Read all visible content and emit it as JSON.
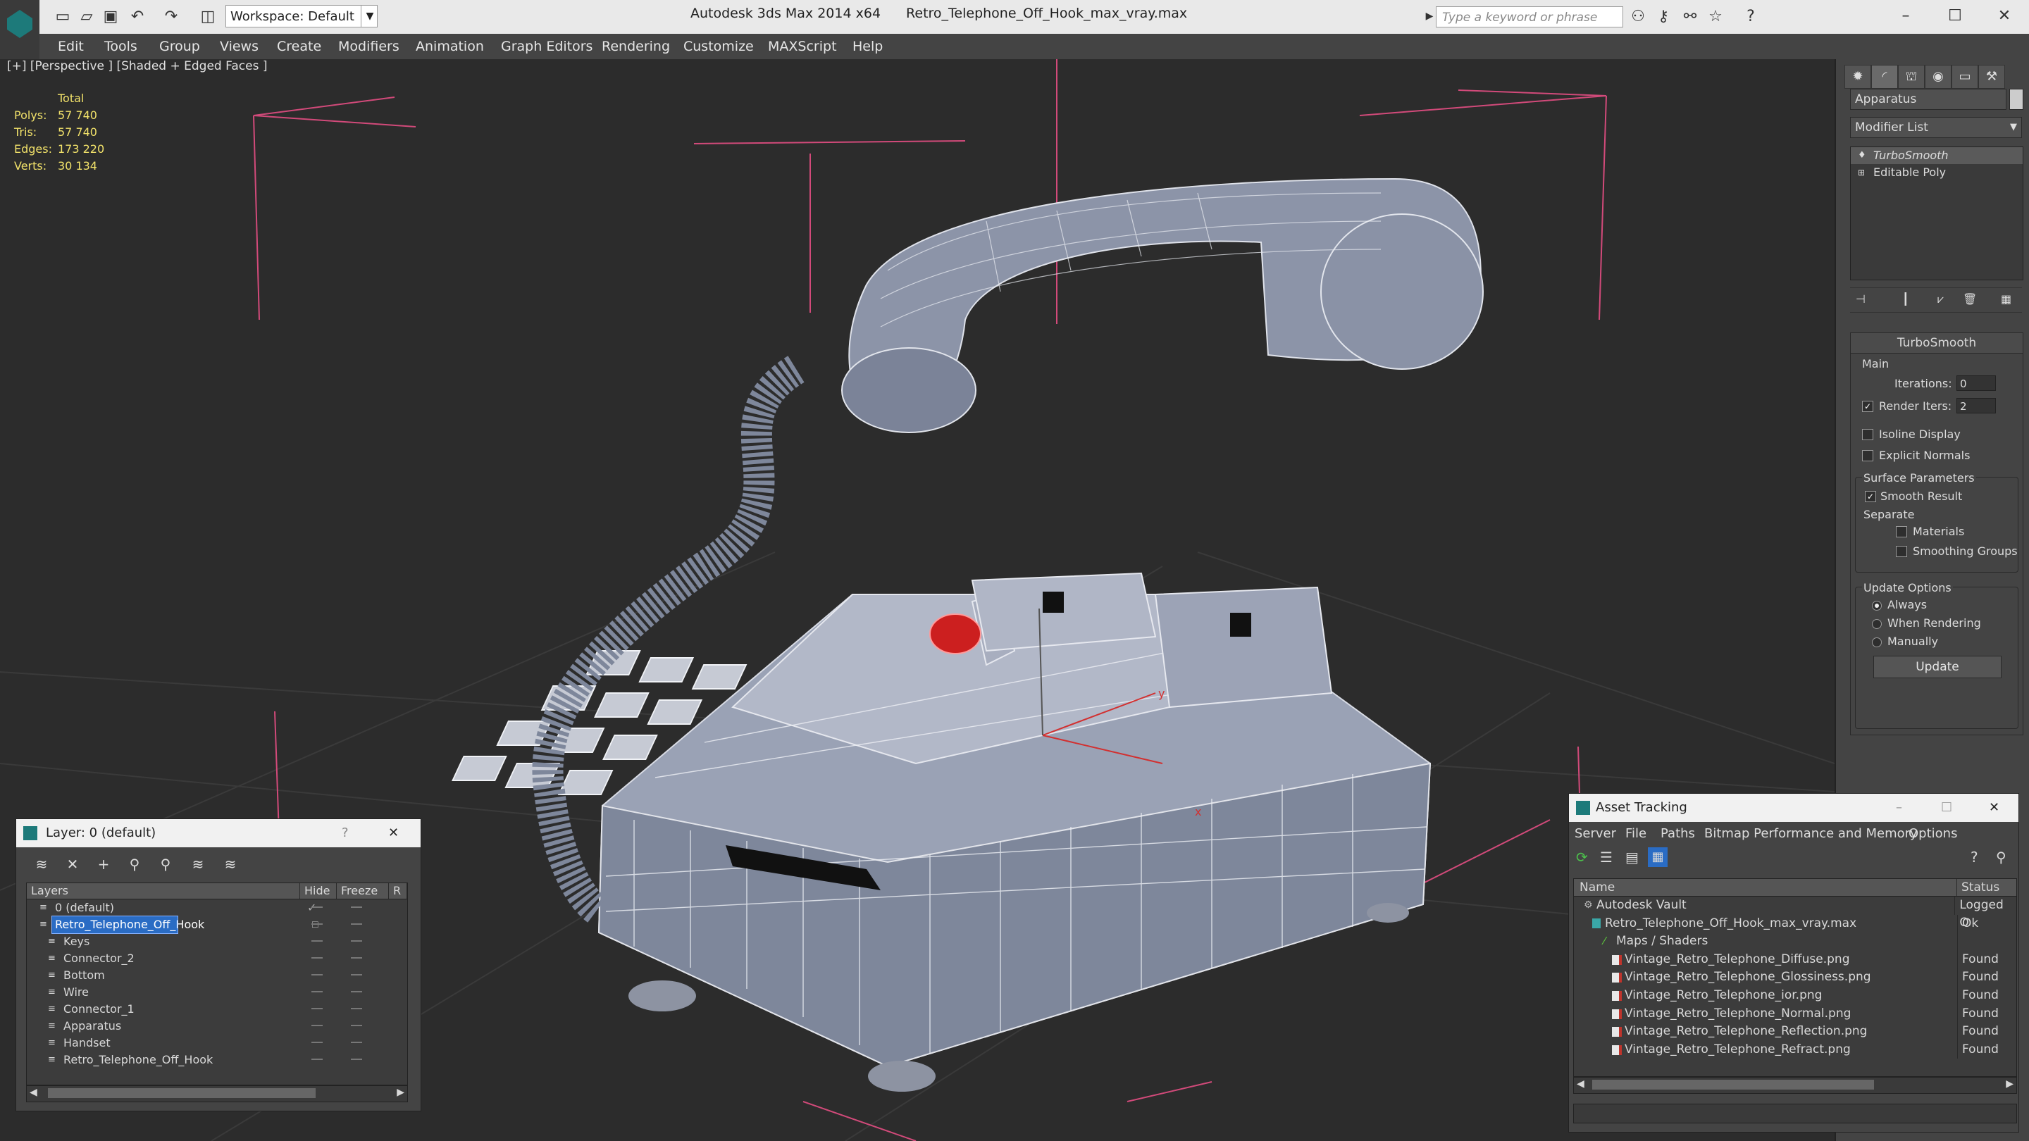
{
  "titlebar": {
    "app": "Autodesk 3ds Max 2014 x64",
    "file": "Retro_Telephone_Off_Hook_max_vray.max",
    "workspace": "Workspace: Default",
    "search_placeholder": "Type a keyword or phrase"
  },
  "menu": [
    "Edit",
    "Tools",
    "Group",
    "Views",
    "Create",
    "Modifiers",
    "Animation",
    "Graph Editors",
    "Rendering",
    "Customize",
    "MAXScript",
    "Help"
  ],
  "viewport": {
    "label": "[+] [Perspective ] [Shaded + Edged Faces ]",
    "stats": {
      "header": "Total",
      "rows": [
        {
          "k": "Polys:",
          "v": "57 740"
        },
        {
          "k": "Tris:",
          "v": "57 740"
        },
        {
          "k": "Edges:",
          "v": "173 220"
        },
        {
          "k": "Verts:",
          "v": "30 134"
        }
      ]
    },
    "axis_labels": {
      "y": "y",
      "x": "x"
    }
  },
  "command_panel": {
    "object_name": "Apparatus",
    "modifier_list": "Modifier List",
    "stack": [
      {
        "label": "TurboSmooth",
        "selected": true
      },
      {
        "label": "Editable Poly",
        "selected": false
      }
    ],
    "rollout_title": "TurboSmooth",
    "main_label": "Main",
    "iterations_label": "Iterations:",
    "iterations_value": "0",
    "render_iters_label": "Render Iters:",
    "render_iters_value": "2",
    "isoline_label": "Isoline Display",
    "explicit_normals_label": "Explicit Normals",
    "surface_params_label": "Surface Parameters",
    "smooth_result_label": "Smooth Result",
    "separate_label": "Separate",
    "materials_label": "Materials",
    "smoothing_groups_label": "Smoothing Groups",
    "update_options_label": "Update Options",
    "always_label": "Always",
    "when_rendering_label": "When Rendering",
    "manually_label": "Manually",
    "update_button": "Update"
  },
  "layer_dialog": {
    "title": "Layer: 0 (default)",
    "help": "?",
    "columns": [
      "Layers",
      "Hide",
      "Freeze",
      "R"
    ],
    "rows": [
      {
        "name": "0 (default)",
        "indent": 1,
        "current": true
      },
      {
        "name": "Retro_Telephone_Off_Hook",
        "indent": 1,
        "selected": true
      },
      {
        "name": "Keys",
        "indent": 2
      },
      {
        "name": "Connector_2",
        "indent": 2
      },
      {
        "name": "Bottom",
        "indent": 2
      },
      {
        "name": "Wire",
        "indent": 2
      },
      {
        "name": "Connector_1",
        "indent": 2
      },
      {
        "name": "Apparatus",
        "indent": 2
      },
      {
        "name": "Handset",
        "indent": 2
      },
      {
        "name": "Retro_Telephone_Off_Hook",
        "indent": 2
      }
    ]
  },
  "asset_tracking": {
    "title": "Asset Tracking",
    "menu": [
      "Server",
      "File",
      "Paths",
      "Bitmap Performance and Memory",
      "Options"
    ],
    "columns": [
      "Name",
      "Status"
    ],
    "rows": [
      {
        "name": "Autodesk Vault",
        "status": "Logged O",
        "indent": 1
      },
      {
        "name": "Retro_Telephone_Off_Hook_max_vray.max",
        "status": "Ok",
        "indent": 2
      },
      {
        "name": "Maps / Shaders",
        "status": "",
        "indent": 3
      },
      {
        "name": "Vintage_Retro_Telephone_Diffuse.png",
        "status": "Found",
        "indent": 4
      },
      {
        "name": "Vintage_Retro_Telephone_Glossiness.png",
        "status": "Found",
        "indent": 4
      },
      {
        "name": "Vintage_Retro_Telephone_ior.png",
        "status": "Found",
        "indent": 4
      },
      {
        "name": "Vintage_Retro_Telephone_Normal.png",
        "status": "Found",
        "indent": 4
      },
      {
        "name": "Vintage_Retro_Telephone_Reflection.png",
        "status": "Found",
        "indent": 4
      },
      {
        "name": "Vintage_Retro_Telephone_Refract.png",
        "status": "Found",
        "indent": 4
      }
    ]
  },
  "colors": {
    "accent": "#2a6cc4",
    "stats": "#f2e26a",
    "grid_line": "#d24a7a"
  }
}
